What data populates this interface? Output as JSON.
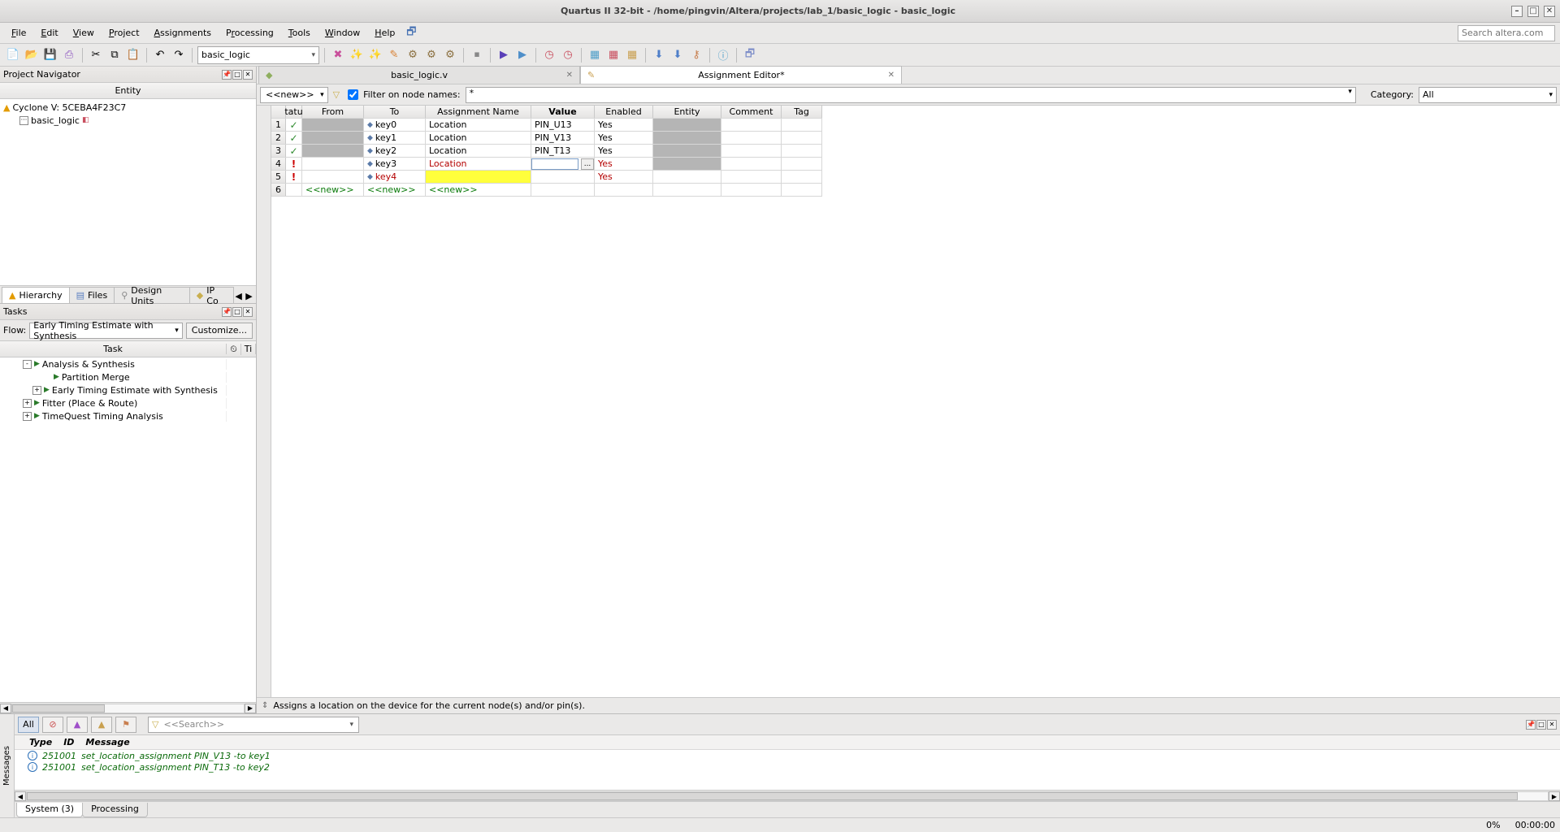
{
  "window": {
    "title": "Quartus II 32-bit - /home/pingvin/Altera/projects/lab_1/basic_logic - basic_logic"
  },
  "menu": [
    "File",
    "Edit",
    "View",
    "Project",
    "Assignments",
    "Processing",
    "Tools",
    "Window",
    "Help"
  ],
  "search_placeholder": "Search altera.com",
  "toolbar_combo": "basic_logic",
  "nav": {
    "title": "Project Navigator",
    "col_header": "Entity",
    "device": "Cyclone V: 5CEBA4F23C7",
    "entity": "basic_logic",
    "tabs": [
      "Hierarchy",
      "Files",
      "Design Units",
      "IP Co"
    ]
  },
  "tasks": {
    "title": "Tasks",
    "flow_label": "Flow:",
    "flow_value": "Early Timing Estimate with Synthesis",
    "customize": "Customize...",
    "col_task": "Task",
    "col_time_abbr": "Ti",
    "items": [
      {
        "indent": 2,
        "exp": "-",
        "label": "Analysis & Synthesis"
      },
      {
        "indent": 4,
        "exp": "",
        "label": "Partition Merge"
      },
      {
        "indent": 3,
        "exp": "+",
        "label": "Early Timing Estimate with Synthesis"
      },
      {
        "indent": 2,
        "exp": "+",
        "label": "Fitter (Place & Route)"
      },
      {
        "indent": 2,
        "exp": "+",
        "label": "TimeQuest Timing Analysis"
      }
    ]
  },
  "editor_tabs": [
    {
      "label": "basic_logic.v",
      "active": false
    },
    {
      "label": "Assignment Editor*",
      "active": true
    }
  ],
  "filter": {
    "new_label": "<<new>>",
    "checkbox_label": "Filter on node names:",
    "value": "*",
    "category_label": "Category:",
    "category_value": "All"
  },
  "grid": {
    "headers": {
      "status": "tatu",
      "from": "From",
      "to": "To",
      "aname": "Assignment Name",
      "value": "Value",
      "enabled": "Enabled",
      "entity": "Entity",
      "comment": "Comment",
      "tag": "Tag"
    },
    "rows": [
      {
        "n": "1",
        "status": "ok",
        "from_disabled": true,
        "to": "key0",
        "aname": "Location",
        "value": "PIN_U13",
        "enabled": "Yes",
        "entity_disabled": true
      },
      {
        "n": "2",
        "status": "ok",
        "from_disabled": true,
        "to": "key1",
        "aname": "Location",
        "value": "PIN_V13",
        "enabled": "Yes",
        "entity_disabled": true
      },
      {
        "n": "3",
        "status": "ok",
        "from_disabled": true,
        "to": "key2",
        "aname": "Location",
        "value": "PIN_T13",
        "enabled": "Yes",
        "entity_disabled": true
      },
      {
        "n": "4",
        "status": "err",
        "from_disabled": false,
        "to": "key3",
        "aname": "Location",
        "aname_red": true,
        "value_edit": true,
        "enabled": "Yes",
        "enabled_red": true,
        "entity_disabled": true
      },
      {
        "n": "5",
        "status": "err",
        "from_disabled": false,
        "to": "key4",
        "to_red": true,
        "aname": "",
        "aname_yellow": true,
        "value": "",
        "enabled": "Yes",
        "enabled_red": true
      },
      {
        "n": "6",
        "status": "",
        "from_new": true,
        "to_new": true,
        "aname_new": true
      }
    ],
    "new_text": "<<new>>"
  },
  "help_line": "Assigns a location on the device for the current node(s) and/or pin(s).",
  "messages": {
    "side_label": "Messages",
    "all": "All",
    "search_placeholder": "<<Search>>",
    "cols": {
      "type": "Type",
      "id": "ID",
      "message": "Message"
    },
    "rows": [
      {
        "id": "251001",
        "text": "set_location_assignment PIN_V13 -to key1"
      },
      {
        "id": "251001",
        "text": "set_location_assignment PIN_T13 -to key2"
      }
    ],
    "tabs": [
      {
        "label": "System (3)",
        "active": true
      },
      {
        "label": "Processing",
        "active": false
      }
    ]
  },
  "status": {
    "pct": "0%",
    "time": "00:00:00"
  }
}
